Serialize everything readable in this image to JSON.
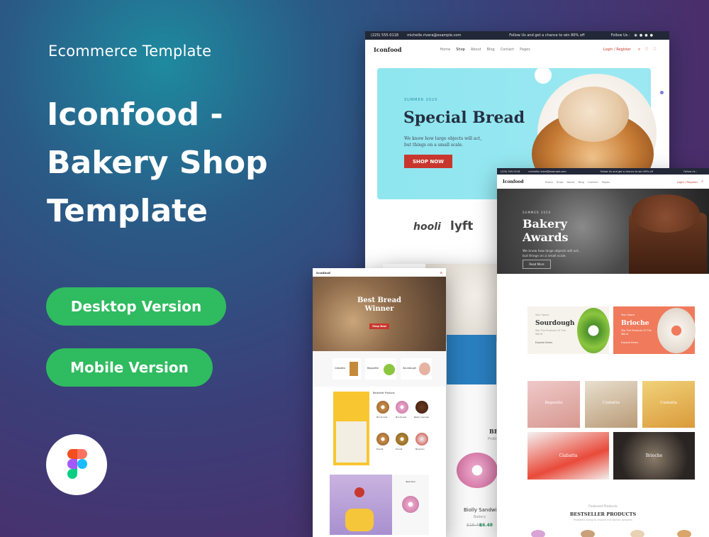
{
  "promo": {
    "subtitle": "Ecommerce Template",
    "title_line1": "Iconfood -",
    "title_line2": "Bakery Shop",
    "title_line3": "Template",
    "desktop_button": "Desktop Version",
    "mobile_button": "Mobile Version"
  },
  "desktop_main": {
    "phone": "(225) 555-0118",
    "email": "michelle.rivera@example.com",
    "follow_offer": "Follow Us and get a chance to win 80% off",
    "follow_us": "Follow Us :",
    "logo": "Iconfood",
    "nav": [
      "Home",
      "Shop",
      "About",
      "Blog",
      "Contact",
      "Pages"
    ],
    "login": "Login / Register",
    "hero_tag": "SUMMER 2020",
    "hero_title": "Special Bread",
    "hero_text_1": "We know how large objects will act,",
    "hero_text_2": "but things on a small scale.",
    "hero_button": "SHOP NOW",
    "brands": [
      "hooli",
      "lyft"
    ]
  },
  "desktop_second": {
    "phone": "(225) 555-0118",
    "email": "michelle.rivera@example.com",
    "follow_offer": "Follow Us and get a chance to win 80% off",
    "follow_us": "Follow Us :",
    "logo": "Iconfood",
    "nav": [
      "Home",
      "Shop",
      "About",
      "Blog",
      "Contact",
      "Pages"
    ],
    "login": "Login / Register",
    "hero_tag": "SUMMER 2020",
    "hero_title_1": "Bakery",
    "hero_title_2": "Awards",
    "hero_text_1": "We know how large objects will act,",
    "hero_text_2": "but things on a small scale.",
    "hero_button": "Read More",
    "card1_tag": "Your Space",
    "card1_title": "Sourdough",
    "card1_text": "Slip The Products Of The World",
    "card1_link": "Explore Items",
    "card2_tag": "Your Space",
    "card2_title": "Brioche",
    "card2_text": "Slip The Products Of The World",
    "card2_link": "Explore Items",
    "categories": [
      "Baguette",
      "Ciabatta",
      "Ciabatta",
      "Ciabatta",
      "Brioche"
    ],
    "featured_label": "Featured Products",
    "bestseller_title": "BESTSELLER PRODUCTS",
    "bestseller_sub": "Problems trying to resolve the conflict between"
  },
  "desktop_third": {
    "bestseller_partial": "BE",
    "bestseller_sub_partial": "Proble",
    "product_name": "Biolly Sandwich",
    "product_cat": "Bakery",
    "old_price": "$16.48",
    "new_price": "$6.48"
  },
  "mobile": {
    "logo": "Iconfood",
    "hero_title_1": "Best Bread",
    "hero_title_2": "Winner",
    "hero_button": "Shop Now",
    "products": [
      "Ciabatta",
      "Baguette",
      "Sourdough"
    ],
    "bestseller_label": "Bestseller Products",
    "donuts": [
      "Mini Donuts",
      "Mini Donuts",
      "Bakery Cupcake",
      "Donuts",
      "Donuts",
      "Macaroon"
    ],
    "profile_tag": "Best Roll",
    "colors": {
      "yellow": "#f7c630",
      "red": "#c8372d",
      "green": "#2fbb5f"
    }
  }
}
